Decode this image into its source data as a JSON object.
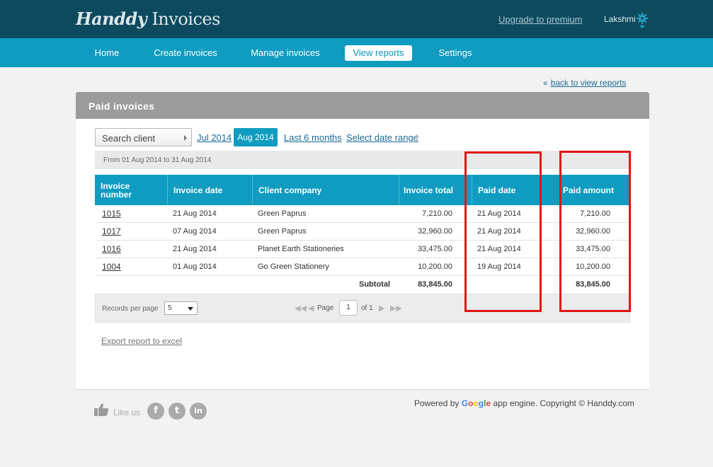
{
  "header": {
    "logo_part1": "Handdy",
    "logo_part2": "Invoices",
    "upgrade_link": "Upgrade to premium",
    "username": "Lakshmi",
    "settings_icon": "gear-icon"
  },
  "nav": {
    "items": [
      "Home",
      "Create invoices",
      "Manage invoices",
      "View reports",
      "Settings"
    ],
    "active_index": 3
  },
  "back_link": "back to view reports",
  "panel": {
    "title": "Paid invoices",
    "search_placeholder": "Search client",
    "filters": {
      "jul": "Jul 2014",
      "aug": "Aug 2014",
      "last6": "Last 6 months",
      "select_range": "Select date range"
    },
    "range_text": "From 01 Aug 2014 to 31 Aug 2014"
  },
  "table": {
    "headers": [
      "Invoice number",
      "Invoice date",
      "Client company",
      "Invoice total",
      "Paid date",
      "Paid amount"
    ],
    "rows": [
      {
        "number": "1015",
        "date": "21 Aug 2014",
        "client": "Green Paprus",
        "total": "7,210.00",
        "paid_date": "21 Aug 2014",
        "paid_amount": "7,210.00"
      },
      {
        "number": "1017",
        "date": "07 Aug 2014",
        "client": "Green Paprus",
        "total": "32,960.00",
        "paid_date": "21 Aug 2014",
        "paid_amount": "32,960.00"
      },
      {
        "number": "1016",
        "date": "21 Aug 2014",
        "client": "Planet Earth Stationeries",
        "total": "33,475.00",
        "paid_date": "21 Aug 2014",
        "paid_amount": "33,475.00"
      },
      {
        "number": "1004",
        "date": "01 Aug 2014",
        "client": "Go Green Stationery",
        "total": "10,200.00",
        "paid_date": "19 Aug 2014",
        "paid_amount": "10,200.00"
      }
    ],
    "subtotal_label": "Subtotal",
    "subtotal_total": "83,845.00",
    "subtotal_paid": "83,845.00"
  },
  "pager": {
    "records_label": "Records per page",
    "records_value": "5",
    "page_label": "Page",
    "page_value": "1",
    "of_label": "of 1"
  },
  "export_link": "Export report to excel",
  "footer": {
    "like_us": "Like us",
    "powered_prefix": "Powered by",
    "google": "Google",
    "powered_suffix": "app engine. Copyright © Handdy.com",
    "google_colors": [
      "#4285f4",
      "#ea4335",
      "#fbbc05",
      "#4285f4",
      "#34a853",
      "#ea4335"
    ]
  },
  "colors": {
    "header_bg": "#0e4a5e",
    "nav_bg": "#0f9cc0",
    "highlight": "#e31414"
  }
}
